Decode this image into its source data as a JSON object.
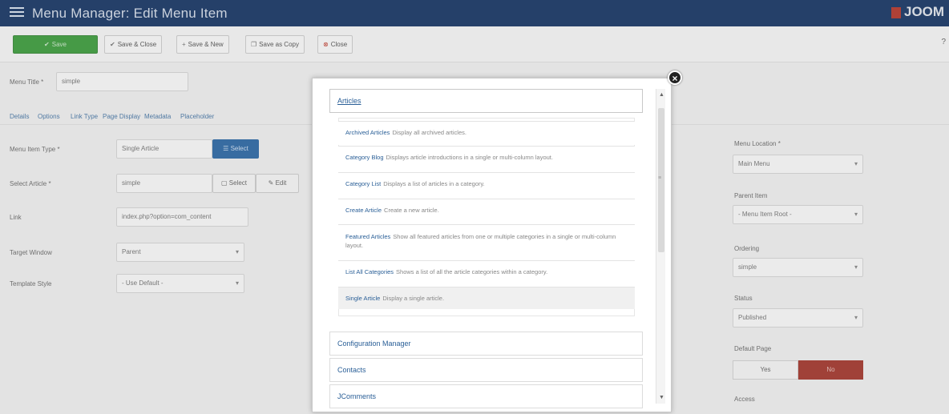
{
  "header": {
    "title": "Menu Manager: Edit Menu Item",
    "brand": "JOOM"
  },
  "toolbar": {
    "save": "Save",
    "save_close": "Save & Close",
    "save_new": "Save & New",
    "save_copy": "Save as Copy",
    "close": "Close",
    "help": "?"
  },
  "form": {
    "menu_title_label": "Menu Title *",
    "menu_title_value": "simple",
    "tabs": [
      "Details",
      "Options",
      "Link Type",
      "Page Display",
      "Metadata",
      "Placeholder"
    ],
    "menu_item_type_label": "Menu Item Type *",
    "menu_item_type_value": "Single Article",
    "select_btn": "Select",
    "select_article_label": "Select Article *",
    "select_article_value": "simple",
    "select_btn2": "Select",
    "edit_btn": "Edit",
    "link_label": "Link",
    "link_value": "index.php?option=com_content",
    "target_window_label": "Target Window",
    "target_window_value": "Parent",
    "template_style_label": "Template Style",
    "template_style_value": "- Use Default -",
    "menu_location_label": "Menu Location *",
    "menu_location_value": "Main Menu",
    "parent_item_label": "Parent Item",
    "parent_item_value": "- Menu Item Root -",
    "ordering_label": "Ordering",
    "ordering_value": "simple",
    "status_label": "Status",
    "status_value": "Published",
    "default_page_label": "Default Page",
    "default_yes": "Yes",
    "default_no": "No",
    "access_label": "Access"
  },
  "modal": {
    "articles_header": "Articles",
    "items": [
      {
        "title": "Archived Articles",
        "desc": "Display all archived articles."
      },
      {
        "title": "Category Blog",
        "desc": "Displays article introductions in a single or multi-column layout."
      },
      {
        "title": "Category List",
        "desc": "Displays a list of articles in a category."
      },
      {
        "title": "Create Article",
        "desc": "Create a new article."
      },
      {
        "title": "Featured Articles",
        "desc": "Show all featured articles from one or multiple categories in a single or multi-column layout."
      },
      {
        "title": "List All Categories",
        "desc": "Shows a list of all the article categories within a category."
      },
      {
        "title": "Single Article",
        "desc": "Display a single article."
      }
    ],
    "groups": [
      "Configuration Manager",
      "Contacts",
      "JComments"
    ],
    "close_symbol": "×"
  }
}
